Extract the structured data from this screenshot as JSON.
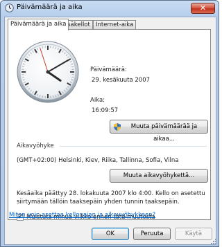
{
  "window": {
    "title": "Päivämäärä ja aika",
    "close_label": "✕"
  },
  "tabs": [
    {
      "label": "Päivämäärä ja aika"
    },
    {
      "label": "Lisäkellot"
    },
    {
      "label": "Internet-aika"
    }
  ],
  "datetime": {
    "date_label": "Päivämäärä:",
    "date_value": "29. kesäkuuta 2007",
    "time_label": "Aika:",
    "time_value": "16:09:57",
    "change_button": "Muuta päivämäärää ja aikaa..."
  },
  "clock": {
    "hours": 16,
    "minutes": 9,
    "seconds": 57
  },
  "timezone": {
    "section_label": "Aikavyöhyke",
    "value": "(GMT+02:00) Helsinki, Kiev, Riika, Tallinna, Sofia, Vilna",
    "change_button": "Muuta aikavyöhykettä..."
  },
  "dst": {
    "info_line1": "Kesäaika päättyy 28. lokakuuta 2007 klo 4:00. Kello on asetettu",
    "info_line2": "siirtymään tällöin taaksepäin yhden tunnin taaksepäin.",
    "remind_label": "Muistuta minua viikko ennen tätä muutosta",
    "remind_checked": true
  },
  "help_link": "Miten voin asettaa kellonajan ja aikavyöhykkeen?",
  "footer": {
    "ok": "OK",
    "cancel": "Peruuta",
    "apply": "Käytä"
  },
  "colors": {
    "link": "#0066cc",
    "close": "#c0311f",
    "title_bg": "#b7cfec"
  }
}
